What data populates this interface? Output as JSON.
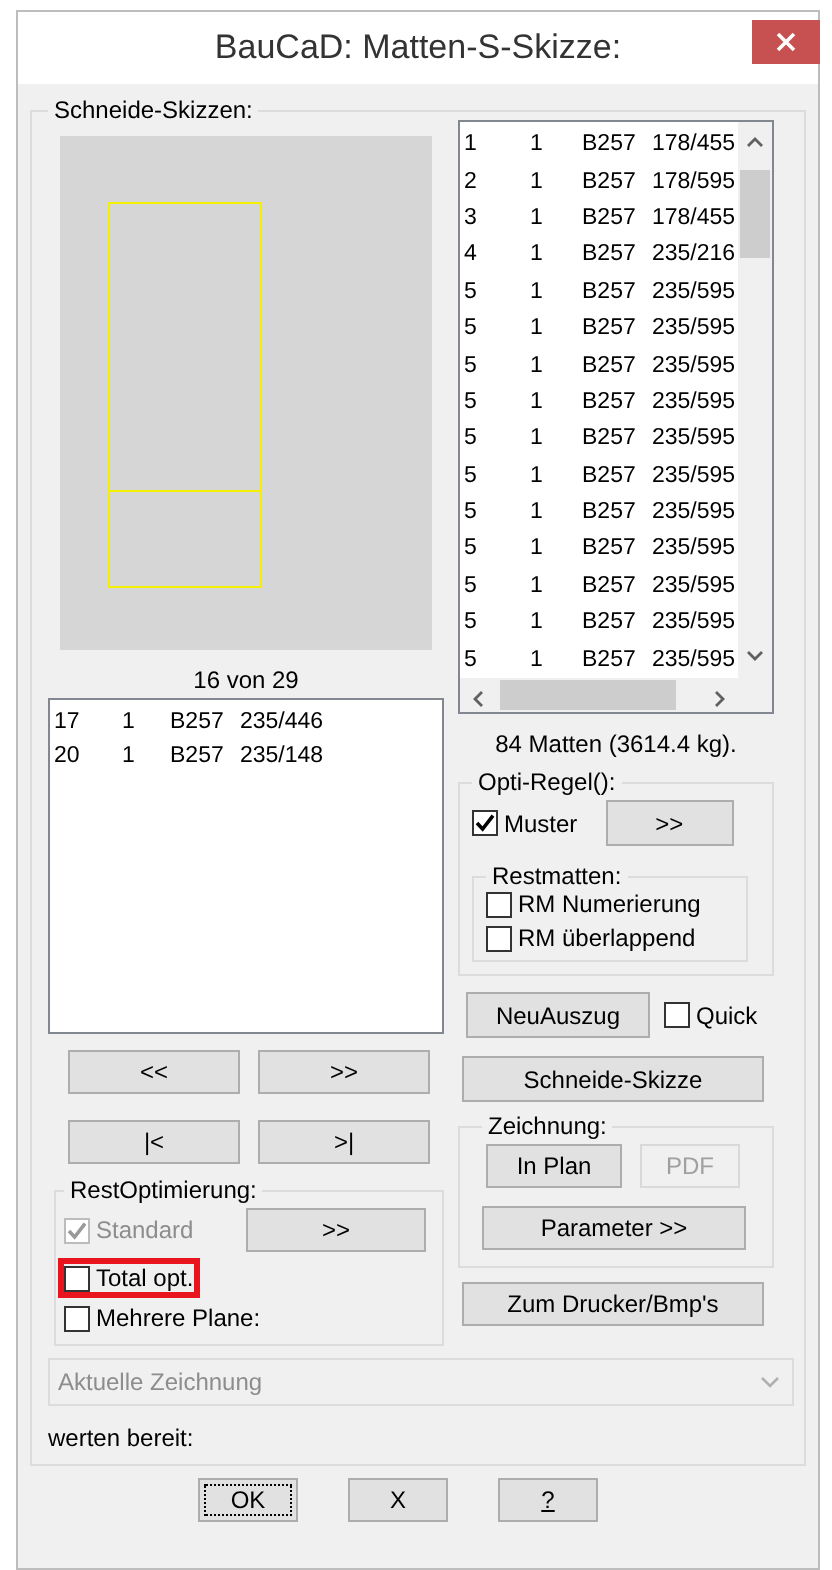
{
  "window": {
    "title": "BauCaD: Matten-S-Skizze:"
  },
  "sketch_group": {
    "title": "Schneide-Skizzen:"
  },
  "matten_list": {
    "rows": [
      [
        "1",
        "1",
        "B257",
        "178/455"
      ],
      [
        "2",
        "1",
        "B257",
        "178/595"
      ],
      [
        "3",
        "1",
        "B257",
        "178/455"
      ],
      [
        "4",
        "1",
        "B257",
        "235/216"
      ],
      [
        "5",
        "1",
        "B257",
        "235/595"
      ],
      [
        "5",
        "1",
        "B257",
        "235/595"
      ],
      [
        "5",
        "1",
        "B257",
        "235/595"
      ],
      [
        "5",
        "1",
        "B257",
        "235/595"
      ],
      [
        "5",
        "1",
        "B257",
        "235/595"
      ],
      [
        "5",
        "1",
        "B257",
        "235/595"
      ],
      [
        "5",
        "1",
        "B257",
        "235/595"
      ],
      [
        "5",
        "1",
        "B257",
        "235/595"
      ],
      [
        "5",
        "1",
        "B257",
        "235/595"
      ],
      [
        "5",
        "1",
        "B257",
        "235/595"
      ],
      [
        "5",
        "1",
        "B257",
        "235/595"
      ]
    ]
  },
  "sketch_caption": "16 von 29",
  "sketch_list": {
    "rows": [
      [
        "17",
        "1",
        "B257",
        "235/446"
      ],
      [
        "20",
        "1",
        "B257",
        "235/148"
      ]
    ]
  },
  "summary": "84 Matten (3614.4 kg).",
  "nav_buttons": [
    "<<",
    ">>",
    "|<",
    ">|"
  ],
  "opti_group": {
    "title": "Opti-Regel():",
    "muster": {
      "label": "Muster",
      "checked": true
    },
    "button": ">>",
    "restmatten": {
      "title": "Restmatten:",
      "options": [
        {
          "label": "RM Numerierung",
          "checked": false
        },
        {
          "label": "RM überlappend",
          "checked": false
        }
      ]
    }
  },
  "neuauszug_button": "NeuAuszug",
  "quick": {
    "label": "Quick",
    "checked": false
  },
  "schneide_button": "Schneide-Skizze",
  "zeichnung_group": {
    "title": "Zeichnung:",
    "buttons": [
      {
        "label": "In Plan",
        "disabled": false
      },
      {
        "label": "PDF",
        "disabled": true
      }
    ],
    "parameter_button": "Parameter >>"
  },
  "drucker_button": "Zum Drucker/Bmp's",
  "rest_group": {
    "title": "RestOptimierung:",
    "standard": {
      "label": "Standard",
      "checked": true,
      "disabled": true
    },
    "button": ">>",
    "options": [
      {
        "label": "Total opt.",
        "checked": false,
        "highlighted": true
      },
      {
        "label": "Mehrere Plane:",
        "checked": false,
        "highlighted": false
      }
    ]
  },
  "dropdown": {
    "value": "Aktuelle Zeichnung",
    "disabled": true
  },
  "status": "werten bereit:",
  "footer_buttons": [
    {
      "label": "OK",
      "focused": true,
      "mnemonic": false
    },
    {
      "label": "X",
      "focused": false,
      "mnemonic": false
    },
    {
      "label": "?",
      "focused": false,
      "mnemonic": true
    }
  ]
}
